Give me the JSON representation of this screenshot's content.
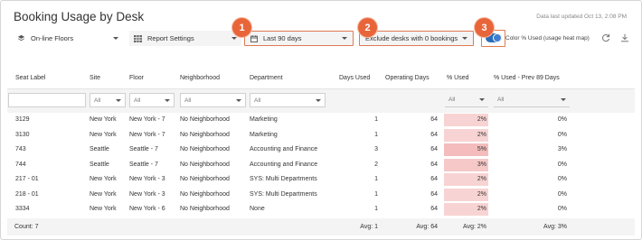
{
  "title": "Booking Usage by Desk",
  "data_updated": "Data last updated Oct 13, 2:08 PM",
  "controls": {
    "floors": "On-line Floors",
    "report_settings": "Report Settings",
    "date_range": "Last 90 days",
    "desk_filter": "Exclude desks with 0 bookings",
    "heatmap_toggle_label": "Color % Used (usage heat map)",
    "heatmap_toggle_on": true
  },
  "callouts": [
    "1",
    "2",
    "3"
  ],
  "columns": [
    "Seat Label",
    "Site",
    "Floor",
    "Neighborhood",
    "Department",
    "Days Used",
    "Operating Days",
    "% Used",
    "% Used - Prev 89 Days"
  ],
  "filters": {
    "site": "All",
    "floor": "All",
    "neighborhood": "All",
    "department": "All",
    "pct_used": "All",
    "pct_prev": "All"
  },
  "rows": [
    {
      "seat": "3129",
      "site": "New York",
      "floor": "New York - 7",
      "neighborhood": "No Neighborhood",
      "department": "Marketing",
      "days_used": "1",
      "operating_days": "64",
      "pct_used": "2%",
      "pct_prev": "0%"
    },
    {
      "seat": "3130",
      "site": "New York",
      "floor": "New York - 7",
      "neighborhood": "No Neighborhood",
      "department": "Marketing",
      "days_used": "1",
      "operating_days": "64",
      "pct_used": "2%",
      "pct_prev": "0%"
    },
    {
      "seat": "743",
      "site": "Seattle",
      "floor": "Seattle - 7",
      "neighborhood": "No Neighborhood",
      "department": "Accounting and Finance",
      "days_used": "3",
      "operating_days": "64",
      "pct_used": "5%",
      "pct_prev": "3%"
    },
    {
      "seat": "744",
      "site": "Seattle",
      "floor": "Seattle - 7",
      "neighborhood": "No Neighborhood",
      "department": "Accounting and Finance",
      "days_used": "2",
      "operating_days": "64",
      "pct_used": "3%",
      "pct_prev": "0%"
    },
    {
      "seat": "217 - 01",
      "site": "New York",
      "floor": "New York - 3",
      "neighborhood": "No Neighborhood",
      "department": "SYS: Multi Departments",
      "days_used": "1",
      "operating_days": "64",
      "pct_used": "2%",
      "pct_prev": "0%"
    },
    {
      "seat": "218 - 01",
      "site": "New York",
      "floor": "New York - 3",
      "neighborhood": "No Neighborhood",
      "department": "SYS: Multi Departments",
      "days_used": "1",
      "operating_days": "64",
      "pct_used": "2%",
      "pct_prev": "0%"
    },
    {
      "seat": "3334",
      "site": "New York",
      "floor": "New York - 6",
      "neighborhood": "No Neighborhood",
      "department": "None",
      "days_used": "1",
      "operating_days": "64",
      "pct_used": "2%",
      "pct_prev": "0%"
    }
  ],
  "footer": {
    "count": "Count: 7",
    "avg_days_used": "Avg: 1",
    "avg_operating_days": "Avg: 64",
    "avg_pct_used": "Avg: 2%",
    "avg_pct_prev": "Avg: 3%"
  },
  "colors": {
    "accent": "#e8653a",
    "toggle": "#2b6cb8",
    "heat_cell": "#f8d3d3"
  }
}
